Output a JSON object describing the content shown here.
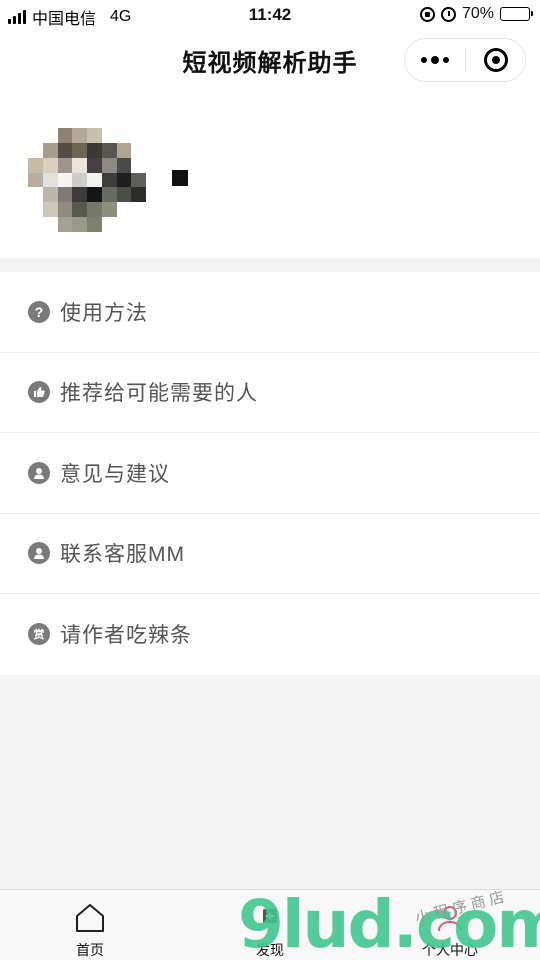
{
  "status_bar": {
    "carrier": "中国电信",
    "network": "4G",
    "time": "11:42",
    "battery": "70%",
    "battery_level": 0.7
  },
  "nav": {
    "title": "短视频解析助手"
  },
  "profile": {
    "nickname": ""
  },
  "menu": {
    "items": [
      {
        "label": "使用方法",
        "icon": "question-icon"
      },
      {
        "label": "推荐给可能需要的人",
        "icon": "thumbs-up-icon"
      },
      {
        "label": "意见与建议",
        "icon": "user-service-icon"
      },
      {
        "label": "联系客服MM",
        "icon": "user-service-icon"
      },
      {
        "label": "请作者吃辣条",
        "icon": "reward-icon",
        "glyph": "赏"
      }
    ]
  },
  "tabs": [
    {
      "label": "首页",
      "icon": "home-icon"
    },
    {
      "label": "发现",
      "icon": "discover-icon"
    },
    {
      "label": "个人中心",
      "icon": "profile-icon"
    }
  ],
  "watermark": {
    "brand": "9lud.com",
    "subtitle": "小程序商店",
    "color": "#3ec78e"
  },
  "colors": {
    "icon_gray": "#7a7a7a",
    "label_gray": "#555555",
    "background": "#f4f4f4"
  }
}
